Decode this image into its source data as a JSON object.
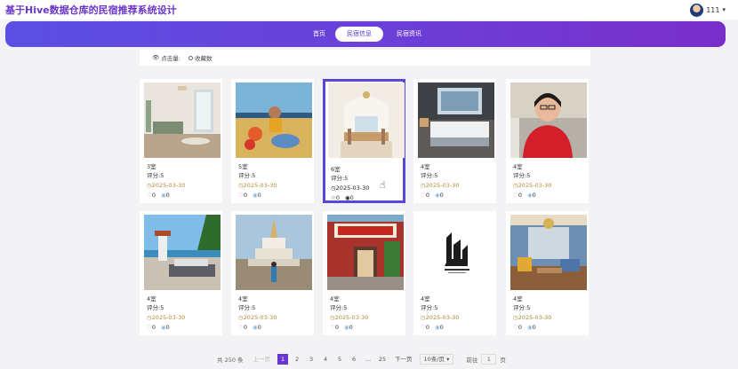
{
  "header": {
    "title": "基于Hive数据仓库的民宿推荐系统设计",
    "username": "111"
  },
  "nav": {
    "items": [
      "首页",
      "民宿信息",
      "民宿资讯"
    ],
    "active_index": 1
  },
  "filters": {
    "views_label": "点击量:",
    "favorites_label": "收藏数"
  },
  "listings": [
    {
      "name": "3室",
      "rating": "评分:5",
      "date": "2025-03-30",
      "likes": "0",
      "views": "0"
    },
    {
      "name": "5室",
      "rating": "评分:5",
      "date": "2025-03-30",
      "likes": "0",
      "views": "0"
    },
    {
      "name": "6室",
      "rating": "评分:5",
      "date": "2025-03-30",
      "likes": "0",
      "views": "0"
    },
    {
      "name": "4室",
      "rating": "评分:5",
      "date": "2025-03-30",
      "likes": "0",
      "views": "0"
    },
    {
      "name": "4室",
      "rating": "评分:5",
      "date": "2025-03-30",
      "likes": "0",
      "views": "0"
    },
    {
      "name": "4室",
      "rating": "评分:5",
      "date": "2025-03-30",
      "likes": "0",
      "views": "0"
    },
    {
      "name": "4室",
      "rating": "评分:5",
      "date": "2025-03-30",
      "likes": "0",
      "views": "0"
    },
    {
      "name": "4室",
      "rating": "评分:5",
      "date": "2025-03-30",
      "likes": "0",
      "views": "0"
    },
    {
      "name": "4室",
      "rating": "评分:5",
      "date": "2025-03-30",
      "likes": "0",
      "views": "0"
    },
    {
      "name": "4室",
      "rating": "评分:5",
      "date": "2025-03-30",
      "likes": "0",
      "views": "0"
    }
  ],
  "pagination": {
    "total": "共 250 条",
    "prev": "上一页",
    "pages": [
      "1",
      "2",
      "3",
      "4",
      "5",
      "6",
      "...",
      "25"
    ],
    "current": "1",
    "next": "下一页",
    "page_size": "10条/页",
    "goto_label": "前往",
    "goto_value": "1",
    "page_suffix": "页"
  },
  "colors": {
    "accent": "#6937d0",
    "nav_gradient_start": "#5b4fe3",
    "nav_gradient_end": "#7a2ec9"
  }
}
